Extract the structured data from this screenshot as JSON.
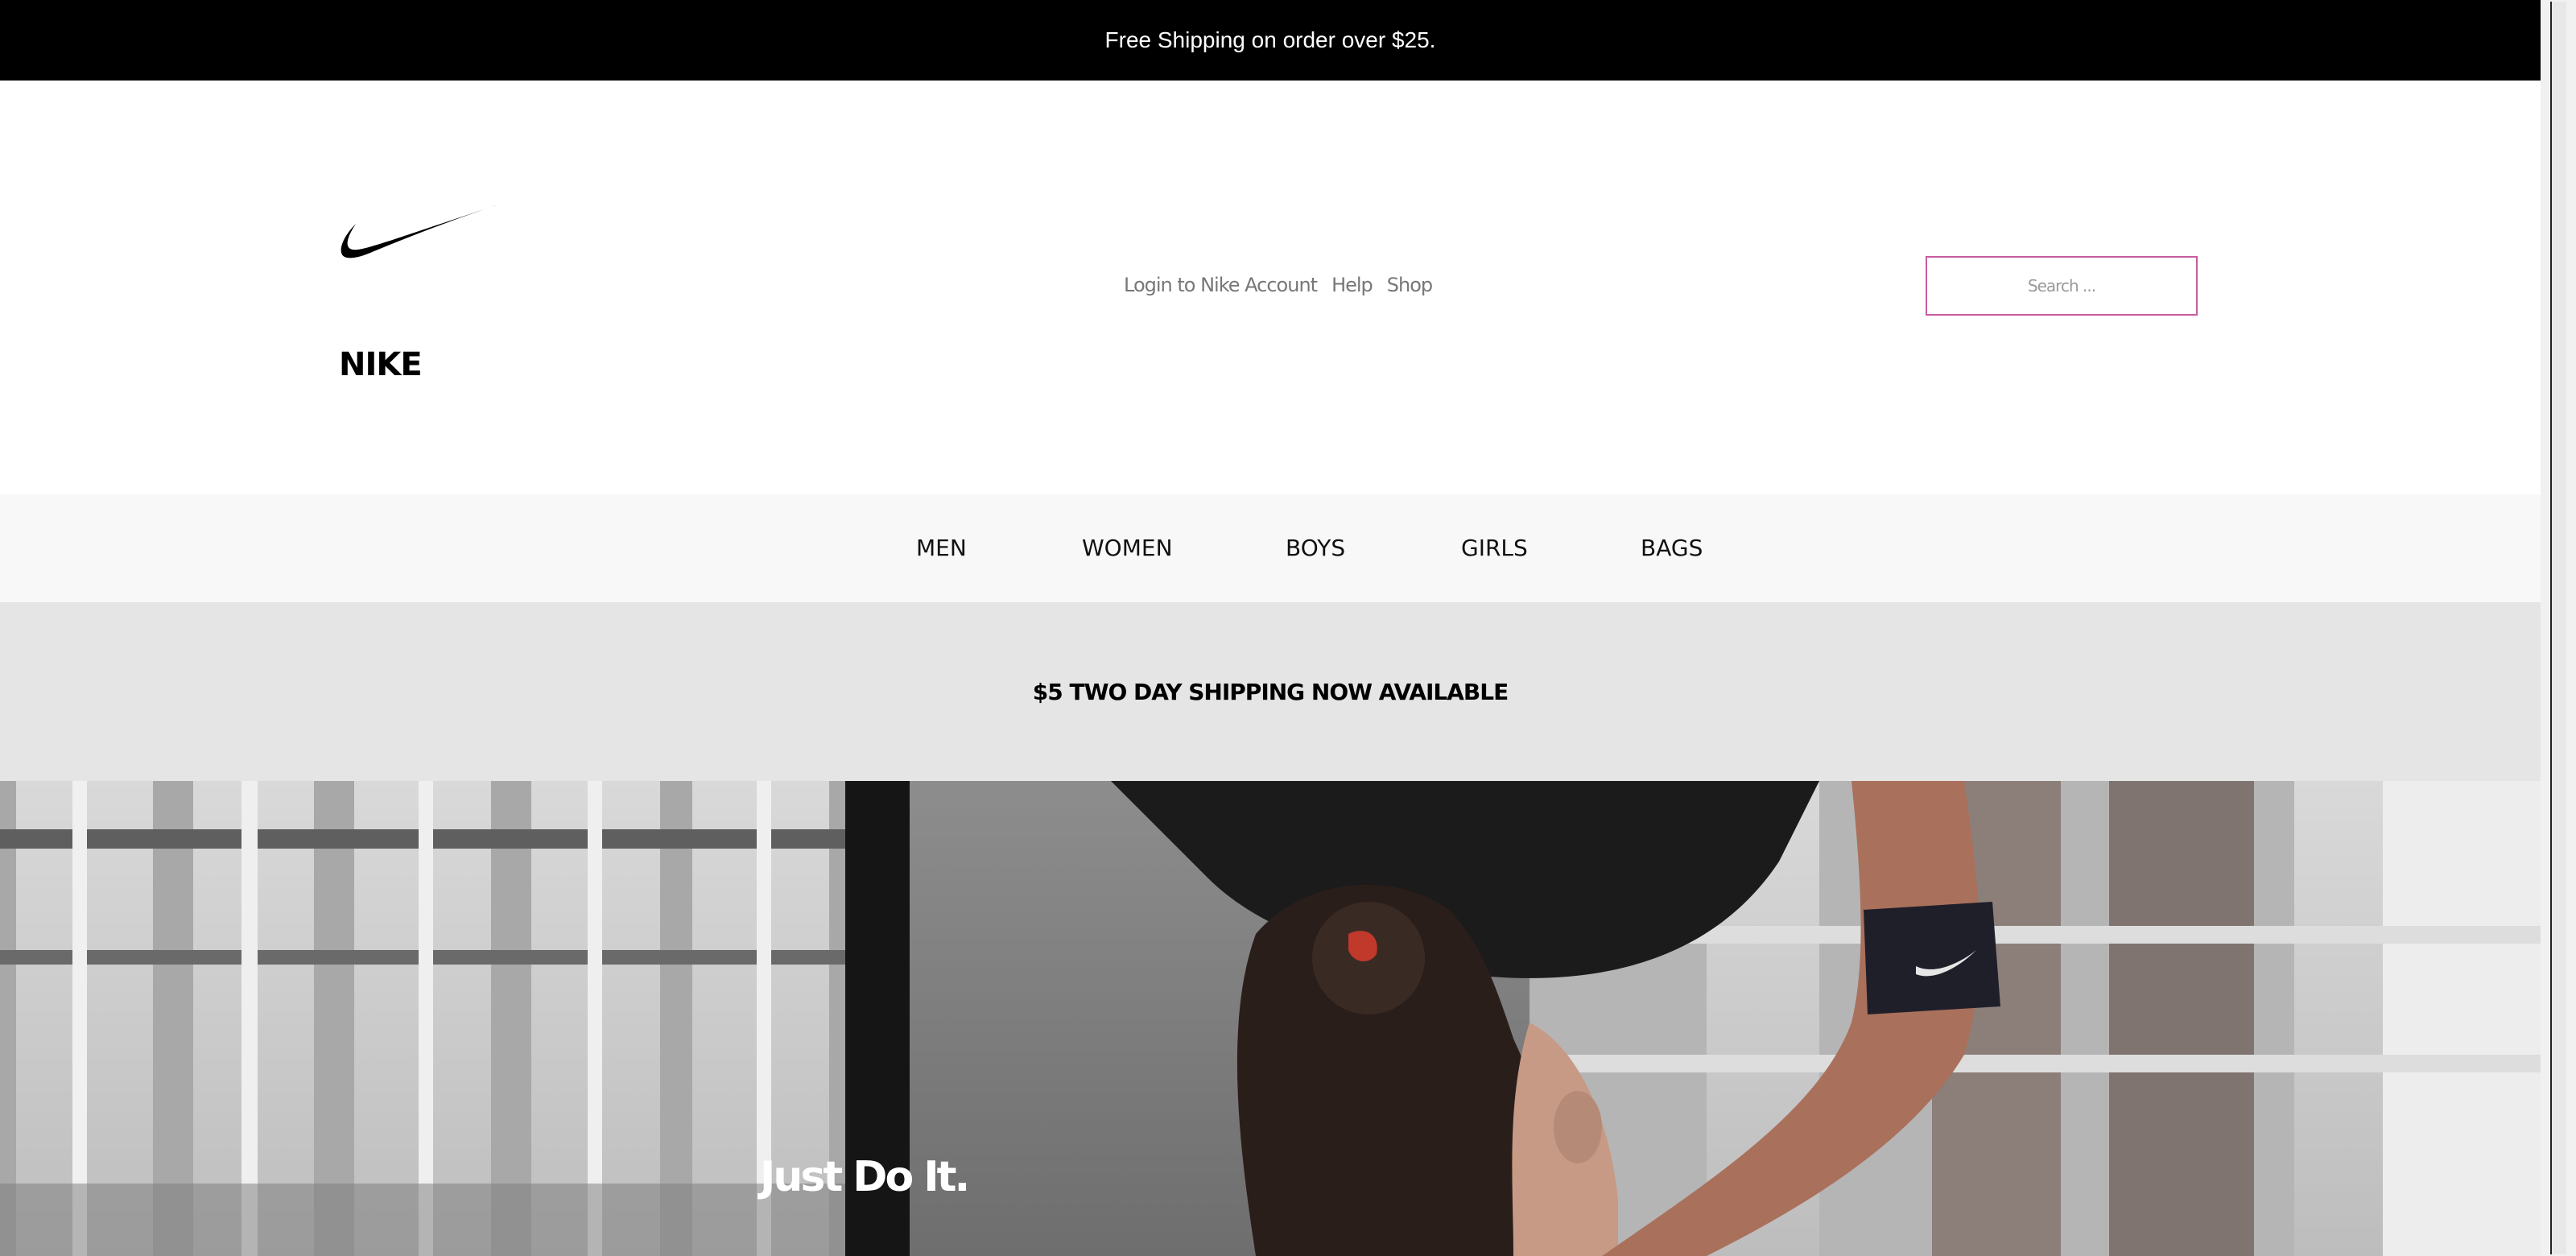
{
  "announcement": {
    "text": "Free Shipping on order over $25."
  },
  "header": {
    "logo_icon": "nike-swoosh-icon",
    "site_title": "NIKE",
    "util_nav": [
      {
        "label": "Login to Nike Account"
      },
      {
        "label": "Help"
      },
      {
        "label": "Shop"
      }
    ],
    "search": {
      "placeholder": "Search ...",
      "value": ""
    }
  },
  "category_nav": [
    {
      "label": "MEN"
    },
    {
      "label": "WOMEN"
    },
    {
      "label": "BOYS"
    },
    {
      "label": "GIRLS"
    },
    {
      "label": "BAGS"
    }
  ],
  "promo": {
    "text": "$5 TWO DAY SHIPPING NOW AVAILABLE"
  },
  "hero": {
    "headline": "Just Do It."
  },
  "colors": {
    "announce_bg": "#000000",
    "nav_bg": "#f8f8f8",
    "promo_bg": "#e5e5e5",
    "search_border": "#c85ba0"
  }
}
